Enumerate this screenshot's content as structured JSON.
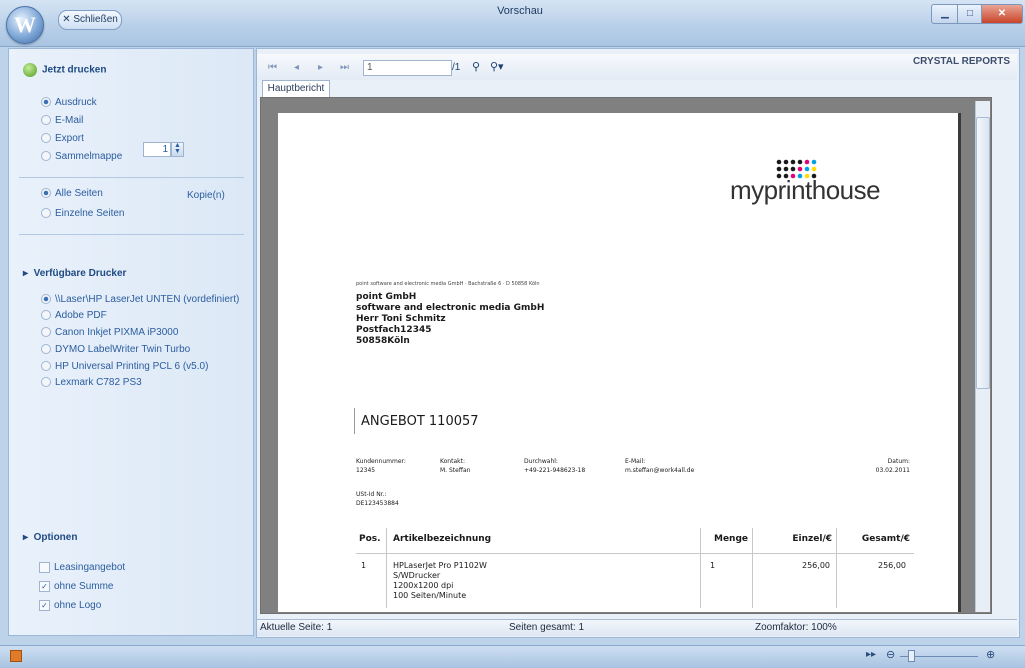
{
  "window": {
    "title": "Vorschau",
    "close_label": "✕ Schließen",
    "orb_label": "W"
  },
  "left": {
    "print_now": "Jetzt drucken",
    "output_options": [
      {
        "label": "Ausdruck",
        "selected": true
      },
      {
        "label": "E-Mail",
        "selected": false
      },
      {
        "label": "Export",
        "selected": false
      },
      {
        "label": "Sammelmappe",
        "selected": false
      }
    ],
    "pages_all": "Alle Seiten",
    "pages_single": "Einzelne Seiten",
    "copies_value": "1",
    "copies_label": "Kopie(n)",
    "printers_heading": "Verfügbare Drucker",
    "printers": [
      {
        "label": "\\\\Laser\\HP LaserJet UNTEN (vordefiniert)",
        "selected": true
      },
      {
        "label": "Adobe PDF",
        "selected": false
      },
      {
        "label": "Canon Inkjet PIXMA iP3000",
        "selected": false
      },
      {
        "label": "DYMO LabelWriter Twin Turbo",
        "selected": false
      },
      {
        "label": "HP Universal Printing PCL 6 (v5.0)",
        "selected": false
      },
      {
        "label": "Lexmark C782 PS3",
        "selected": false
      }
    ],
    "options_heading": "Optionen",
    "options": [
      {
        "label": "Leasingangebot",
        "checked": false
      },
      {
        "label": "ohne Summe",
        "checked": true
      },
      {
        "label": "ohne Logo",
        "checked": true
      }
    ]
  },
  "viewer": {
    "page_input": "1",
    "page_total": "/1",
    "brand": "CRYSTAL REPORTS",
    "tab": "Hauptbericht",
    "status_current": "Aktuelle Seite: 1",
    "status_total": "Seiten gesamt: 1",
    "status_zoom": "Zoomfaktor: 100%"
  },
  "document": {
    "logo_my": "my",
    "logo_rest": "printhouse",
    "sender_line": "point software and electronic media GmbH · Bachstraße 6 · D 50858 Köln",
    "address": [
      "point GmbH",
      "software and electronic media GmbH",
      "Herr Toni Schmitz",
      "Postfach12345",
      "50858Köln"
    ],
    "offer_title": "ANGEBOT 110057",
    "meta": [
      {
        "label": "Kundennummer:",
        "value": "12345"
      },
      {
        "label": "Kontakt:",
        "value": "M. Steffan"
      },
      {
        "label": "Durchwahl:",
        "value": "+49-221-948623-18"
      },
      {
        "label": "E-Mail:",
        "value": "m.steffan@work4all.de"
      },
      {
        "label": "Datum:",
        "value": "03.02.2011"
      }
    ],
    "ust_label": "USt-Id Nr.:",
    "ust_value": "DE123453884",
    "table_headers": [
      "Pos.",
      "Artikelbezeichnung",
      "Menge",
      "Einzel/€",
      "Gesamt/€"
    ],
    "row": {
      "pos": "1",
      "desc": [
        "HPLaserJet Pro P1102W",
        "S/WDrucker",
        "1200x1200 dpi",
        "100 Seiten/Minute"
      ],
      "qty": "1",
      "unit": "256,00",
      "total": "256,00"
    }
  },
  "colors": {
    "accent": "#2b5d9e",
    "dot_colors": [
      "#1a1a1a",
      "#e6007e",
      "#00a0e3",
      "#ffde00"
    ]
  }
}
